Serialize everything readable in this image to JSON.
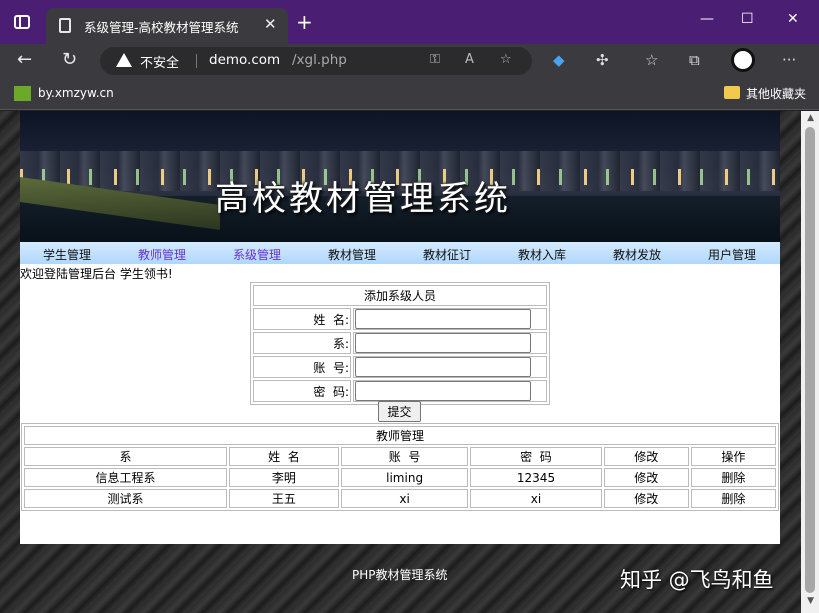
{
  "browser": {
    "tab_title": "系级管理-高校教材管理系统",
    "tab_close": "✕",
    "new_tab": "+",
    "security_label": "不安全",
    "url_host": "demo.com",
    "url_path": "/xgl.php",
    "bookmark_label": "by.xmzyw.cn",
    "other_bookmarks": "其他收藏夹",
    "icons": [
      "sidebar-icon",
      "page-icon",
      "back-icon",
      "refresh-icon",
      "warning-icon",
      "key-icon",
      "read-aloud-icon",
      "favorite-add-icon",
      "extension-icon",
      "puzzle-icon",
      "favorites-icon",
      "collections-icon",
      "profile-icon",
      "more-icon"
    ]
  },
  "site": {
    "banner_title": "高校教材管理系统",
    "nav": [
      {
        "label": "学生管理"
      },
      {
        "label": "教师管理"
      },
      {
        "label": "系级管理"
      },
      {
        "label": "教材管理"
      },
      {
        "label": "教材征订"
      },
      {
        "label": "教材入库"
      },
      {
        "label": "教材发放"
      },
      {
        "label": "用户管理"
      }
    ],
    "welcome": "欢迎登陆管理后台 学生领书!"
  },
  "form": {
    "title": "添加系级人员",
    "fields": [
      {
        "label": "姓  名:",
        "value": ""
      },
      {
        "label": "系:",
        "value": ""
      },
      {
        "label": "账  号:",
        "value": ""
      },
      {
        "label": "密  码:",
        "value": ""
      }
    ],
    "submit": "提交"
  },
  "table": {
    "title": "教师管理",
    "headers": [
      "系",
      "姓  名",
      "账  号",
      "密  码",
      "修改",
      "操作"
    ],
    "rows": [
      [
        "信息工程系",
        "李明",
        "liming",
        "12345",
        "修改",
        "删除"
      ],
      [
        "测试系",
        "王五",
        "xi",
        "xi",
        "修改",
        "删除"
      ]
    ]
  },
  "footer": {
    "text": "PHP教材管理系统",
    "watermark": "知乎 @飞鸟和鱼"
  }
}
